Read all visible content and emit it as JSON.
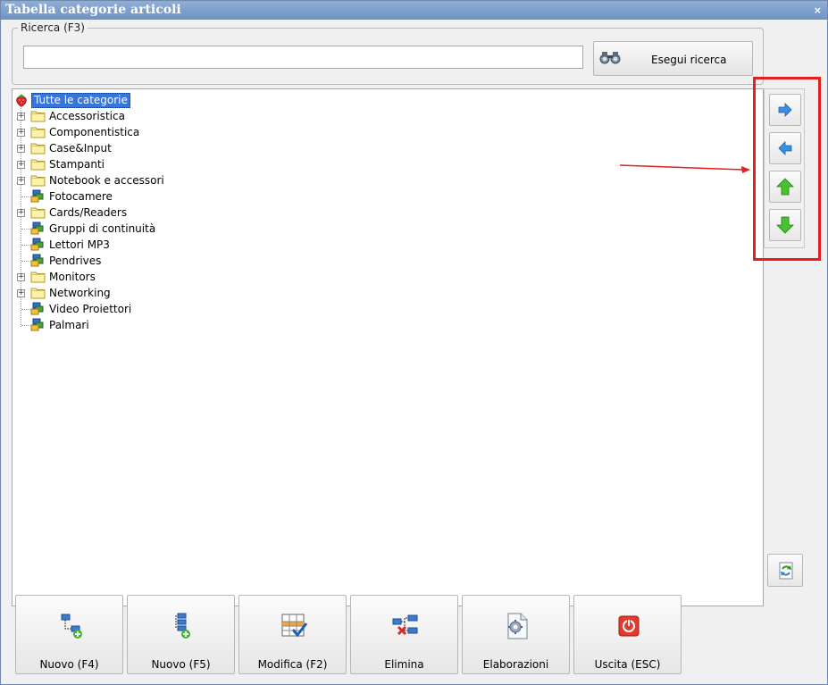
{
  "window": {
    "title": "Tabella categorie articoli",
    "close_glyph": "×"
  },
  "search": {
    "group_label": "Ricerca (F3)",
    "value": "",
    "placeholder": "",
    "button_label": "Esegui ricerca",
    "button_icon": "binoculars-icon"
  },
  "tree": {
    "root": {
      "label": "Tutte le categorie",
      "icon": "strawberry-icon"
    },
    "items": [
      {
        "label": "Accessoristica",
        "icon": "folder-icon",
        "expandable": true
      },
      {
        "label": "Componentistica",
        "icon": "folder-icon",
        "expandable": true
      },
      {
        "label": "Case&Input",
        "icon": "folder-icon",
        "expandable": true
      },
      {
        "label": "Stampanti",
        "icon": "folder-icon",
        "expandable": true
      },
      {
        "label": "Notebook e accessori",
        "icon": "folder-icon",
        "expandable": true
      },
      {
        "label": "Fotocamere",
        "icon": "category-leaf-icon",
        "expandable": false
      },
      {
        "label": "Cards/Readers",
        "icon": "folder-icon",
        "expandable": true
      },
      {
        "label": "Gruppi di continuità",
        "icon": "category-leaf-icon",
        "expandable": false
      },
      {
        "label": "Lettori MP3",
        "icon": "category-leaf-icon",
        "expandable": false
      },
      {
        "label": "Pendrives",
        "icon": "category-leaf-icon",
        "expandable": false
      },
      {
        "label": "Monitors",
        "icon": "folder-icon",
        "expandable": true
      },
      {
        "label": "Networking",
        "icon": "folder-icon",
        "expandable": true
      },
      {
        "label": "Video Proiettori",
        "icon": "category-leaf-icon",
        "expandable": false
      },
      {
        "label": "Palmari",
        "icon": "category-leaf-icon",
        "expandable": false
      }
    ],
    "expander_glyph": "+"
  },
  "nav_buttons": [
    {
      "name": "move-right",
      "icon": "arrow-right-icon"
    },
    {
      "name": "move-left",
      "icon": "arrow-left-icon"
    },
    {
      "name": "move-up",
      "icon": "arrow-up-icon"
    },
    {
      "name": "move-down",
      "icon": "arrow-down-icon"
    }
  ],
  "refresh_button": {
    "icon": "refresh-icon"
  },
  "toolbar": {
    "buttons": [
      {
        "label": "Nuovo (F4)",
        "icon": "new-sibling-node-icon"
      },
      {
        "label": "Nuovo (F5)",
        "icon": "new-child-node-icon"
      },
      {
        "label": "Modifica (F2)",
        "icon": "edit-table-icon"
      },
      {
        "label": "Elimina",
        "icon": "delete-node-icon"
      },
      {
        "label": "Elaborazioni",
        "icon": "gear-document-icon"
      },
      {
        "label": "Uscita (ESC)",
        "icon": "power-exit-icon"
      }
    ]
  },
  "colors": {
    "titlebar": "#7ea1cf",
    "selection": "#3875d7",
    "highlight_box": "#e31f1f",
    "arrow_blue": "#3b8fe0",
    "arrow_green": "#3dbb2b"
  }
}
